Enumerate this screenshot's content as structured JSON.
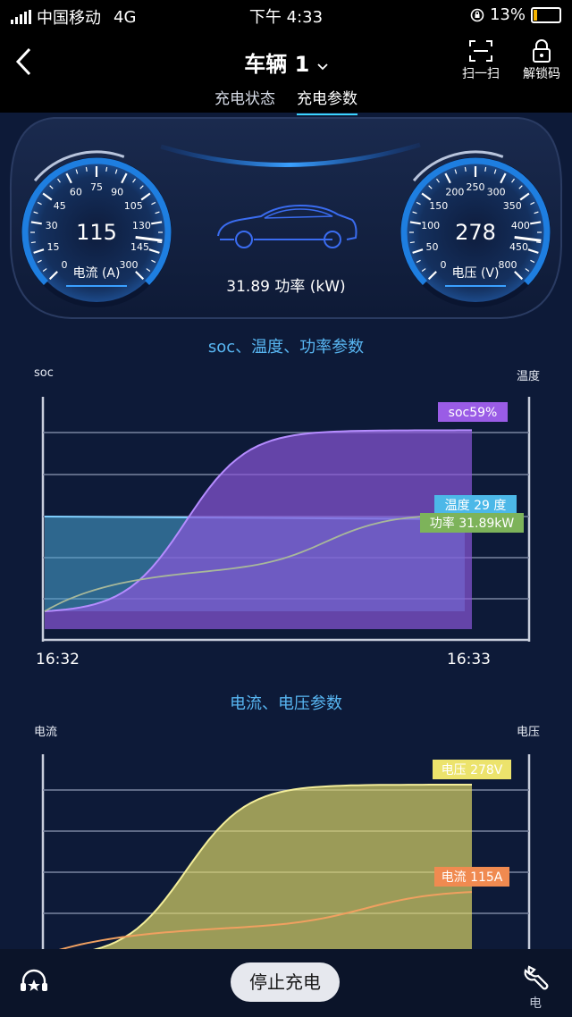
{
  "status_bar": {
    "carrier": "中国移动",
    "network": "4G",
    "time": "下午 4:33",
    "battery": "13%",
    "battery_level": 0.13
  },
  "header": {
    "title": "车辆 1",
    "scan_label": "扫一扫",
    "unlock_label": "解锁码"
  },
  "tabs": [
    {
      "label": "充电状态",
      "active": false
    },
    {
      "label": "充电参数",
      "active": true
    }
  ],
  "dashboard": {
    "current": {
      "value": "115",
      "label": "电流 (A)",
      "ticks": [
        "0",
        "15",
        "30",
        "45",
        "60",
        "75",
        "90",
        "105",
        "130",
        "145",
        "300"
      ]
    },
    "voltage": {
      "value": "278",
      "label": "电压 (V)",
      "ticks": [
        "0",
        "50",
        "100",
        "150",
        "200",
        "250",
        "300",
        "350",
        "400",
        "450",
        "800"
      ]
    },
    "power_text": "31.89 功率 (kW)"
  },
  "chart1": {
    "title": "soc、温度、功率参数",
    "left_axis": "soc",
    "right_axis": "温度",
    "start_time": "16:32",
    "end_time": "16:33"
  },
  "chart2": {
    "title": "电流、电压参数",
    "left_axis": "电流",
    "right_axis": "电压"
  },
  "chart_data": [
    {
      "type": "area",
      "title": "soc、温度、功率参数",
      "x": [
        "16:32",
        "16:33"
      ],
      "series": [
        {
          "name": "soc",
          "label": "soc59%",
          "values": [
            0,
            59
          ],
          "color": "#8a57d8"
        },
        {
          "name": "温度",
          "label": "温度 29 度",
          "values": [
            29,
            29
          ],
          "color": "#4aa8d6"
        },
        {
          "name": "功率",
          "label": "功率 31.89kW",
          "values": [
            0,
            31.89
          ],
          "color": "#8fc06a"
        }
      ]
    },
    {
      "type": "area",
      "title": "电流、电压参数",
      "series": [
        {
          "name": "电压",
          "label": "电压 278V",
          "values": [
            0,
            278
          ],
          "color": "#e8e06a"
        },
        {
          "name": "电流",
          "label": "电流 115A",
          "values": [
            0,
            115
          ],
          "color": "#f0a060"
        }
      ]
    }
  ],
  "bottom": {
    "stop_label": "停止充电",
    "watermark": "电"
  },
  "colors": {
    "accent": "#3bd4ff",
    "gauge_blue": "#1e7ee0",
    "background": "#0d1a38"
  }
}
